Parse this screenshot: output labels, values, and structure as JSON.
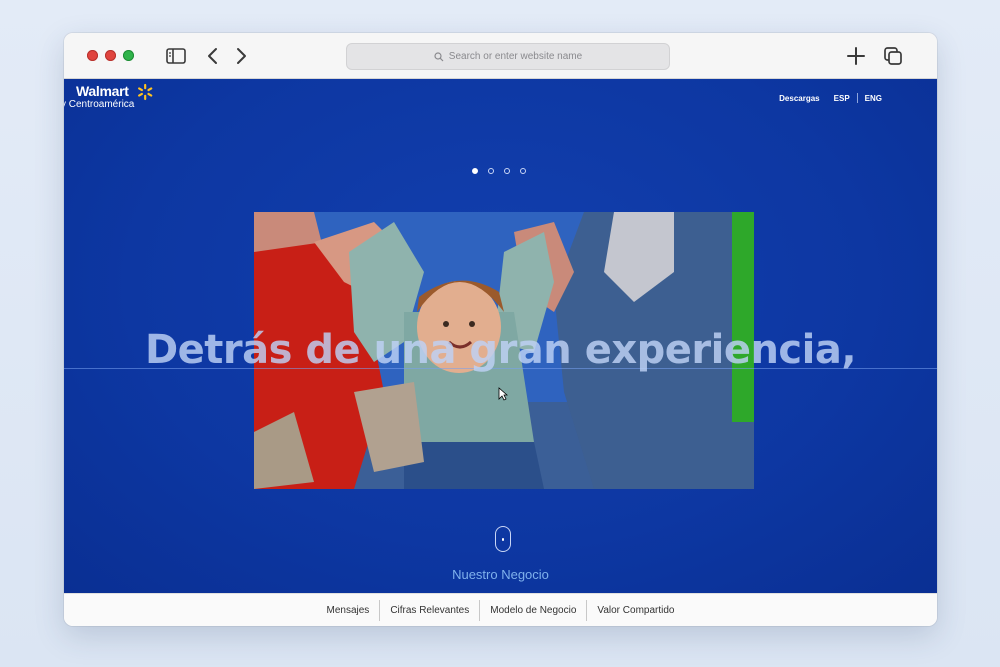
{
  "browser": {
    "address_placeholder": "Search or enter website name"
  },
  "site": {
    "brand": "Walmart",
    "brand_sub": "y Centroamérica",
    "topnav": [
      "Descargas",
      "ESP",
      "ENG"
    ],
    "carousel": {
      "slides": 4,
      "active": 1
    },
    "headline": "Detrás de una gran experiencia,",
    "section_label": "Nuestro Negocio",
    "subnav": [
      "Mensajes",
      "Cifras Relevantes",
      "Modelo de Negocio",
      "Valor Compartido"
    ]
  },
  "colors": {
    "brand_blue": "#0d37a2",
    "spark_yellow": "#ffc220"
  }
}
